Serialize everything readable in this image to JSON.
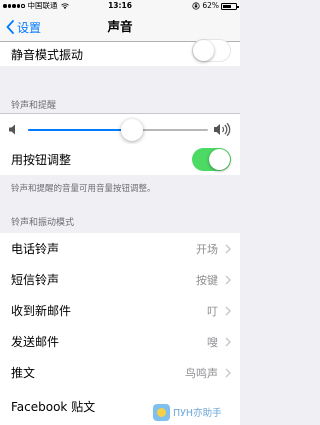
{
  "status_bar": {
    "carrier": "中国联通",
    "time": "13:16",
    "battery_percent": "62%",
    "battery_level": 0.62,
    "signal_bars_filled": 4
  },
  "nav": {
    "back_label": "设置",
    "title": "声音"
  },
  "vibrate_row": {
    "label": "静音模式振动",
    "enabled": false
  },
  "ringer_section": {
    "header": "铃声和提醒",
    "volume_level": 0.58,
    "button_adjust_label": "用按钮调整",
    "button_adjust_enabled": true,
    "footer": "铃声和提醒的音量可用音量按钮调整。"
  },
  "patterns_section": {
    "header": "铃声和振动模式",
    "items": [
      {
        "label": "电话铃声",
        "value": "开场"
      },
      {
        "label": "短信铃声",
        "value": "按键"
      },
      {
        "label": "收到新邮件",
        "value": "叮"
      },
      {
        "label": "发送邮件",
        "value": "嗖"
      },
      {
        "label": "推文",
        "value": "鸟鸣声"
      },
      {
        "label": "Facebook 贴文",
        "value": ""
      }
    ]
  },
  "watermark": {
    "text": "ПУН亦助手"
  },
  "colors": {
    "accent": "#007aff",
    "switch_on": "#4cd964",
    "background": "#efeff4"
  }
}
